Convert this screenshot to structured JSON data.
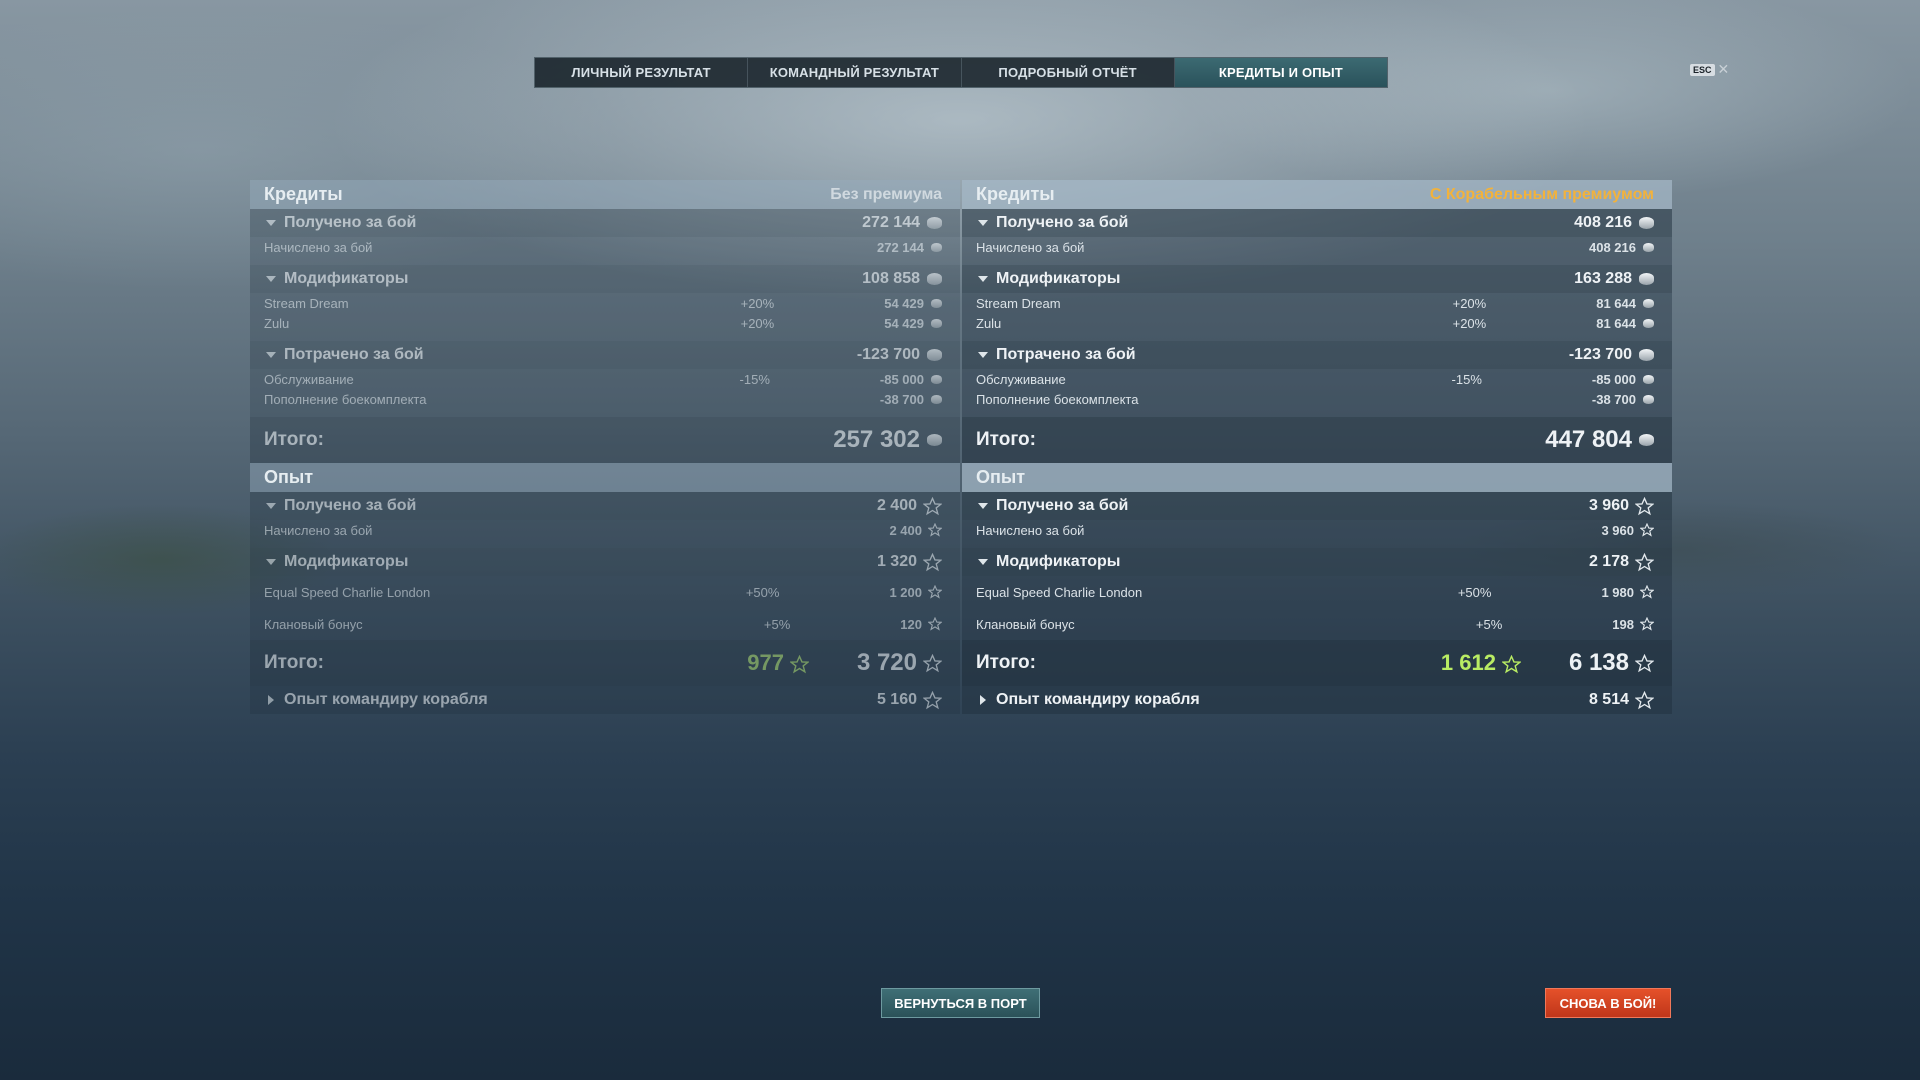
{
  "tabs": [
    "ЛИЧНЫЙ РЕЗУЛЬТАТ",
    "КОМАНДНЫЙ РЕЗУЛЬТАТ",
    "ПОДРОБНЫЙ ОТЧЁТ",
    "КРЕДИТЫ И ОПЫТ"
  ],
  "active_tab": "КРЕДИТЫ И ОПЫТ",
  "esc": {
    "key": "ESC",
    "close": "✕"
  },
  "left": {
    "credits": {
      "title": "Кредиты",
      "subtitle": "Без премиума",
      "earned": {
        "label": "Получено за бой",
        "value": "272 144"
      },
      "earned_row": {
        "label": "Начислено за бой",
        "value": "272 144"
      },
      "modifiers": {
        "label": "Модификаторы",
        "value": "108 858"
      },
      "mod1": {
        "label": "Stream Dream",
        "pct": "+20%",
        "value": "54 429"
      },
      "mod2": {
        "label": "Zulu",
        "pct": "+20%",
        "value": "54 429"
      },
      "spent": {
        "label": "Потрачено за бой",
        "value": "-123 700"
      },
      "service": {
        "label": "Обслуживание",
        "pct": "-15%",
        "value": "-85 000"
      },
      "ammo": {
        "label": "Пополнение боекомплекта",
        "value": "-38 700"
      },
      "total_label": "Итого:",
      "total": "257 302"
    },
    "xp": {
      "title": "Опыт",
      "earned": {
        "label": "Получено за бой",
        "value": "2 400"
      },
      "earned_row": {
        "label": "Начислено за бой",
        "value": "2 400"
      },
      "modifiers": {
        "label": "Модификаторы",
        "value": "1 320"
      },
      "mod1": {
        "label": "Equal Speed Charlie London",
        "pct": "+50%",
        "value": "1 200"
      },
      "mod2": {
        "label": "Клановый бонус",
        "pct": "+5%",
        "value": "120"
      },
      "total_label": "Итого:",
      "free": "977",
      "total": "3 720",
      "commander": {
        "label": "Опыт командиру корабля",
        "value": "5 160"
      }
    }
  },
  "right": {
    "credits": {
      "title": "Кредиты",
      "subtitle": "С Корабельным премиумом",
      "earned": {
        "label": "Получено за бой",
        "value": "408 216"
      },
      "earned_row": {
        "label": "Начислено за бой",
        "value": "408 216"
      },
      "modifiers": {
        "label": "Модификаторы",
        "value": "163 288"
      },
      "mod1": {
        "label": "Stream Dream",
        "pct": "+20%",
        "value": "81 644"
      },
      "mod2": {
        "label": "Zulu",
        "pct": "+20%",
        "value": "81 644"
      },
      "spent": {
        "label": "Потрачено за бой",
        "value": "-123 700"
      },
      "service": {
        "label": "Обслуживание",
        "pct": "-15%",
        "value": "-85 000"
      },
      "ammo": {
        "label": "Пополнение боекомплекта",
        "value": "-38 700"
      },
      "total_label": "Итого:",
      "total": "447 804"
    },
    "xp": {
      "title": "Опыт",
      "earned": {
        "label": "Получено за бой",
        "value": "3 960"
      },
      "earned_row": {
        "label": "Начислено за бой",
        "value": "3 960"
      },
      "modifiers": {
        "label": "Модификаторы",
        "value": "2 178"
      },
      "mod1": {
        "label": "Equal Speed Charlie London",
        "pct": "+50%",
        "value": "1 980"
      },
      "mod2": {
        "label": "Клановый бонус",
        "pct": "+5%",
        "value": "198"
      },
      "total_label": "Итого:",
      "free": "1 612",
      "total": "6 138",
      "commander": {
        "label": "Опыт командиру корабля",
        "value": "8 514"
      }
    }
  },
  "buttons": {
    "port": "ВЕРНУТЬСЯ В ПОРТ",
    "battle": "СНОВА В БОЙ!"
  },
  "colors": {
    "premium_accent": "#f2b23c",
    "free_xp": "#b9ec63",
    "battle_button": "#d8441f",
    "port_button": "#356068"
  }
}
